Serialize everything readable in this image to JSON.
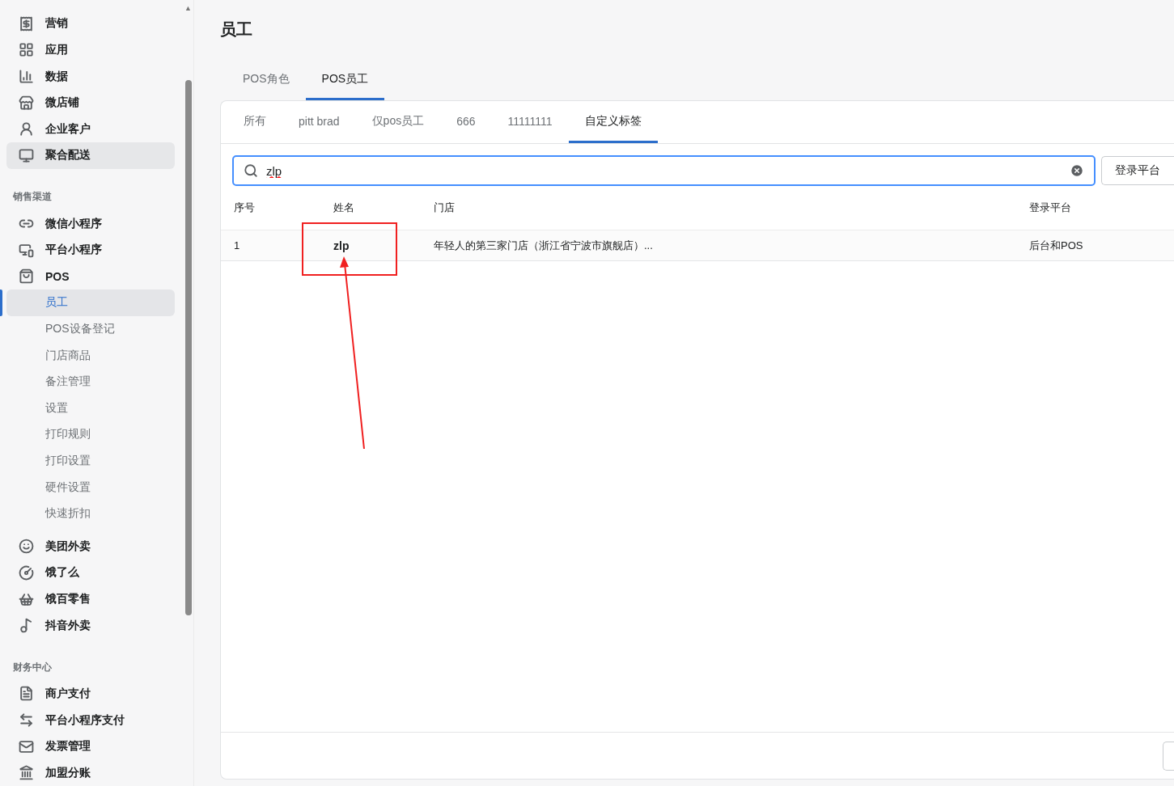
{
  "sidebar": {
    "scroll_up": "▲",
    "items": [
      {
        "kind": "main",
        "label": "营销",
        "selected": false,
        "highlighted": false
      },
      {
        "kind": "main",
        "label": "应用",
        "selected": false,
        "highlighted": false
      },
      {
        "kind": "main",
        "label": "数据",
        "selected": false,
        "highlighted": false
      },
      {
        "kind": "main",
        "label": "微店铺",
        "selected": false,
        "highlighted": false
      },
      {
        "kind": "main",
        "label": "企业客户",
        "selected": false,
        "highlighted": false
      },
      {
        "kind": "main",
        "label": "聚合配送",
        "selected": false,
        "highlighted": true
      },
      {
        "kind": "section",
        "label": "销售渠道",
        "selected": false,
        "highlighted": false
      },
      {
        "kind": "main",
        "label": "微信小程序",
        "selected": false,
        "highlighted": false
      },
      {
        "kind": "main",
        "label": "平台小程序",
        "selected": false,
        "highlighted": false
      },
      {
        "kind": "main",
        "label": "POS",
        "selected": false,
        "highlighted": false
      },
      {
        "kind": "sub",
        "label": "员工",
        "selected": true,
        "highlighted": false
      },
      {
        "kind": "sub",
        "label": "POS设备登记",
        "selected": false,
        "highlighted": false
      },
      {
        "kind": "sub",
        "label": "门店商品",
        "selected": false,
        "highlighted": false
      },
      {
        "kind": "sub",
        "label": "备注管理",
        "selected": false,
        "highlighted": false
      },
      {
        "kind": "sub",
        "label": "设置",
        "selected": false,
        "highlighted": false
      },
      {
        "kind": "sub",
        "label": "打印规则",
        "selected": false,
        "highlighted": false
      },
      {
        "kind": "sub",
        "label": "打印设置",
        "selected": false,
        "highlighted": false
      },
      {
        "kind": "sub",
        "label": "硬件设置",
        "selected": false,
        "highlighted": false
      },
      {
        "kind": "sub",
        "label": "快速折扣",
        "selected": false,
        "highlighted": false
      },
      {
        "kind": "main",
        "label": "美团外卖",
        "selected": false,
        "highlighted": false
      },
      {
        "kind": "main",
        "label": "饿了么",
        "selected": false,
        "highlighted": false
      },
      {
        "kind": "main",
        "label": "饿百零售",
        "selected": false,
        "highlighted": false
      },
      {
        "kind": "main",
        "label": "抖音外卖",
        "selected": false,
        "highlighted": false
      },
      {
        "kind": "section",
        "label": "财务中心",
        "selected": false,
        "highlighted": false
      },
      {
        "kind": "main",
        "label": "商户支付",
        "selected": false,
        "highlighted": false
      },
      {
        "kind": "main",
        "label": "平台小程序支付",
        "selected": false,
        "highlighted": false
      },
      {
        "kind": "main",
        "label": "发票管理",
        "selected": false,
        "highlighted": false
      },
      {
        "kind": "main",
        "label": "加盟分账",
        "selected": false,
        "highlighted": false
      }
    ]
  },
  "page_title": "员工",
  "tabs": [
    {
      "label": "POS角色",
      "selected": false
    },
    {
      "label": "POS员工",
      "selected": true
    }
  ],
  "filter_tabs": [
    {
      "label": "所有",
      "selected": false
    },
    {
      "label": "pitt brad",
      "selected": false
    },
    {
      "label": "仅pos员工",
      "selected": false
    },
    {
      "label": "666",
      "selected": false
    },
    {
      "label": "11111111",
      "selected": false
    },
    {
      "label": "自定义标签",
      "selected": true
    }
  ],
  "search": {
    "value": "zlp"
  },
  "filter_button": "登录平台",
  "table": {
    "columns": [
      "序号",
      "姓名",
      "门店",
      "登录平台"
    ],
    "rows": [
      [
        "1",
        "zlp",
        "年轻人的第三家门店（浙江省宁波市旗舰店）...",
        "后台和POS"
      ]
    ]
  }
}
